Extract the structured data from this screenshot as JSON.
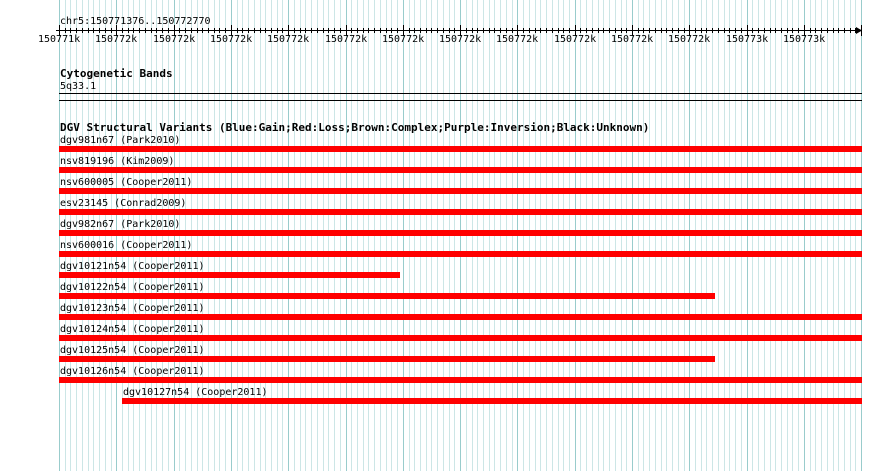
{
  "ruler": {
    "region": "chr5:150771376..150772770",
    "ticks": [
      "150771k",
      "150772k",
      "150772k",
      "150772k",
      "150772k",
      "150772k",
      "150772k",
      "150772k",
      "150772k",
      "150772k",
      "150772k",
      "150772k",
      "150773k",
      "150773k"
    ]
  },
  "cytobands": {
    "title": "Cytogenetic Bands",
    "band": "5q33.1"
  },
  "dgv": {
    "title": "DGV Structural Variants (Blue:Gain;Red:Loss;Brown:Complex;Purple:Inversion;Black:Unknown)",
    "color": "#ff0000",
    "features": [
      {
        "label": "dgv981n67 (Park2010)",
        "start": 0,
        "end": 1
      },
      {
        "label": "nsv819196 (Kim2009)",
        "start": 0,
        "end": 1
      },
      {
        "label": "nsv600005 (Cooper2011)",
        "start": 0,
        "end": 1
      },
      {
        "label": "esv23145 (Conrad2009)",
        "start": 0,
        "end": 1
      },
      {
        "label": "dgv982n67 (Park2010)",
        "start": 0,
        "end": 1
      },
      {
        "label": "nsv600016 (Cooper2011)",
        "start": 0,
        "end": 1
      },
      {
        "label": "dgv10121n54 (Cooper2011)",
        "start": 0,
        "end": 0.425
      },
      {
        "label": "dgv10122n54 (Cooper2011)",
        "start": 0,
        "end": 0.817
      },
      {
        "label": "dgv10123n54 (Cooper2011)",
        "start": 0,
        "end": 1
      },
      {
        "label": "dgv10124n54 (Cooper2011)",
        "start": 0,
        "end": 1
      },
      {
        "label": "dgv10125n54 (Cooper2011)",
        "start": 0,
        "end": 0.817
      },
      {
        "label": "dgv10126n54 (Cooper2011)",
        "start": 0,
        "end": 1
      },
      {
        "label": "dgv10127n54 (Cooper2011)",
        "start": 0.079,
        "end": 1
      }
    ]
  }
}
